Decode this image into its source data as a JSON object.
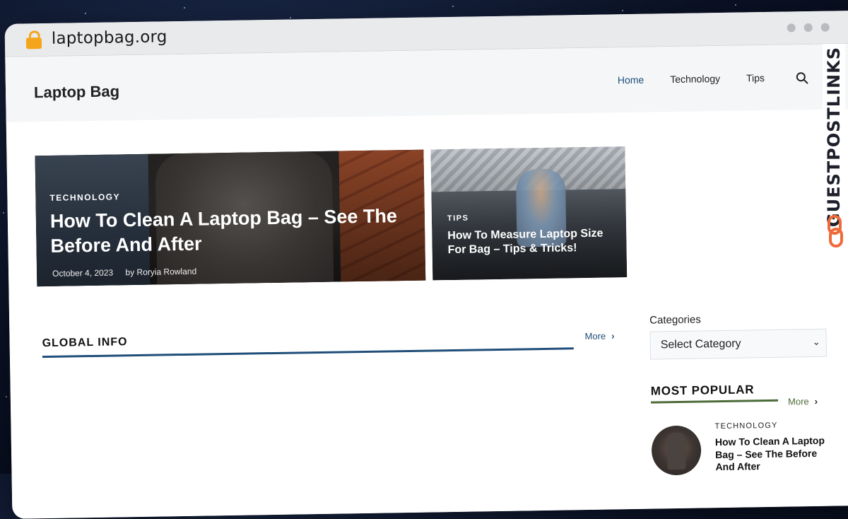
{
  "browser": {
    "url": "laptopbag.org"
  },
  "site": {
    "logo": "Laptop Bag",
    "nav": [
      "Home",
      "Technology",
      "Tips"
    ]
  },
  "hero": {
    "category": "TECHNOLOGY",
    "title": "How To Clean A Laptop Bag – See The Before And After",
    "date": "October 4, 2023",
    "author": "by Roryia Rowland"
  },
  "side_post": {
    "category": "TIPS",
    "title": "How To Measure Laptop Size For Bag – Tips & Tricks!"
  },
  "section": {
    "title": "GLOBAL INFO",
    "more": "More"
  },
  "sidebar": {
    "categories_label": "Categories",
    "select_placeholder": "Select Category",
    "popular_title": "MOST POPULAR",
    "popular_more": "More",
    "popular_item": {
      "category": "TECHNOLOGY",
      "title": "How To Clean A Laptop Bag – See The Before And After"
    }
  },
  "watermark": {
    "text": "GUESTPOSTLINKS"
  },
  "colors": {
    "accent_blue": "#1f4e79",
    "accent_green": "#4d6b3a",
    "lock": "#f4a51c",
    "watermark_logo": "#ef6a3a"
  }
}
